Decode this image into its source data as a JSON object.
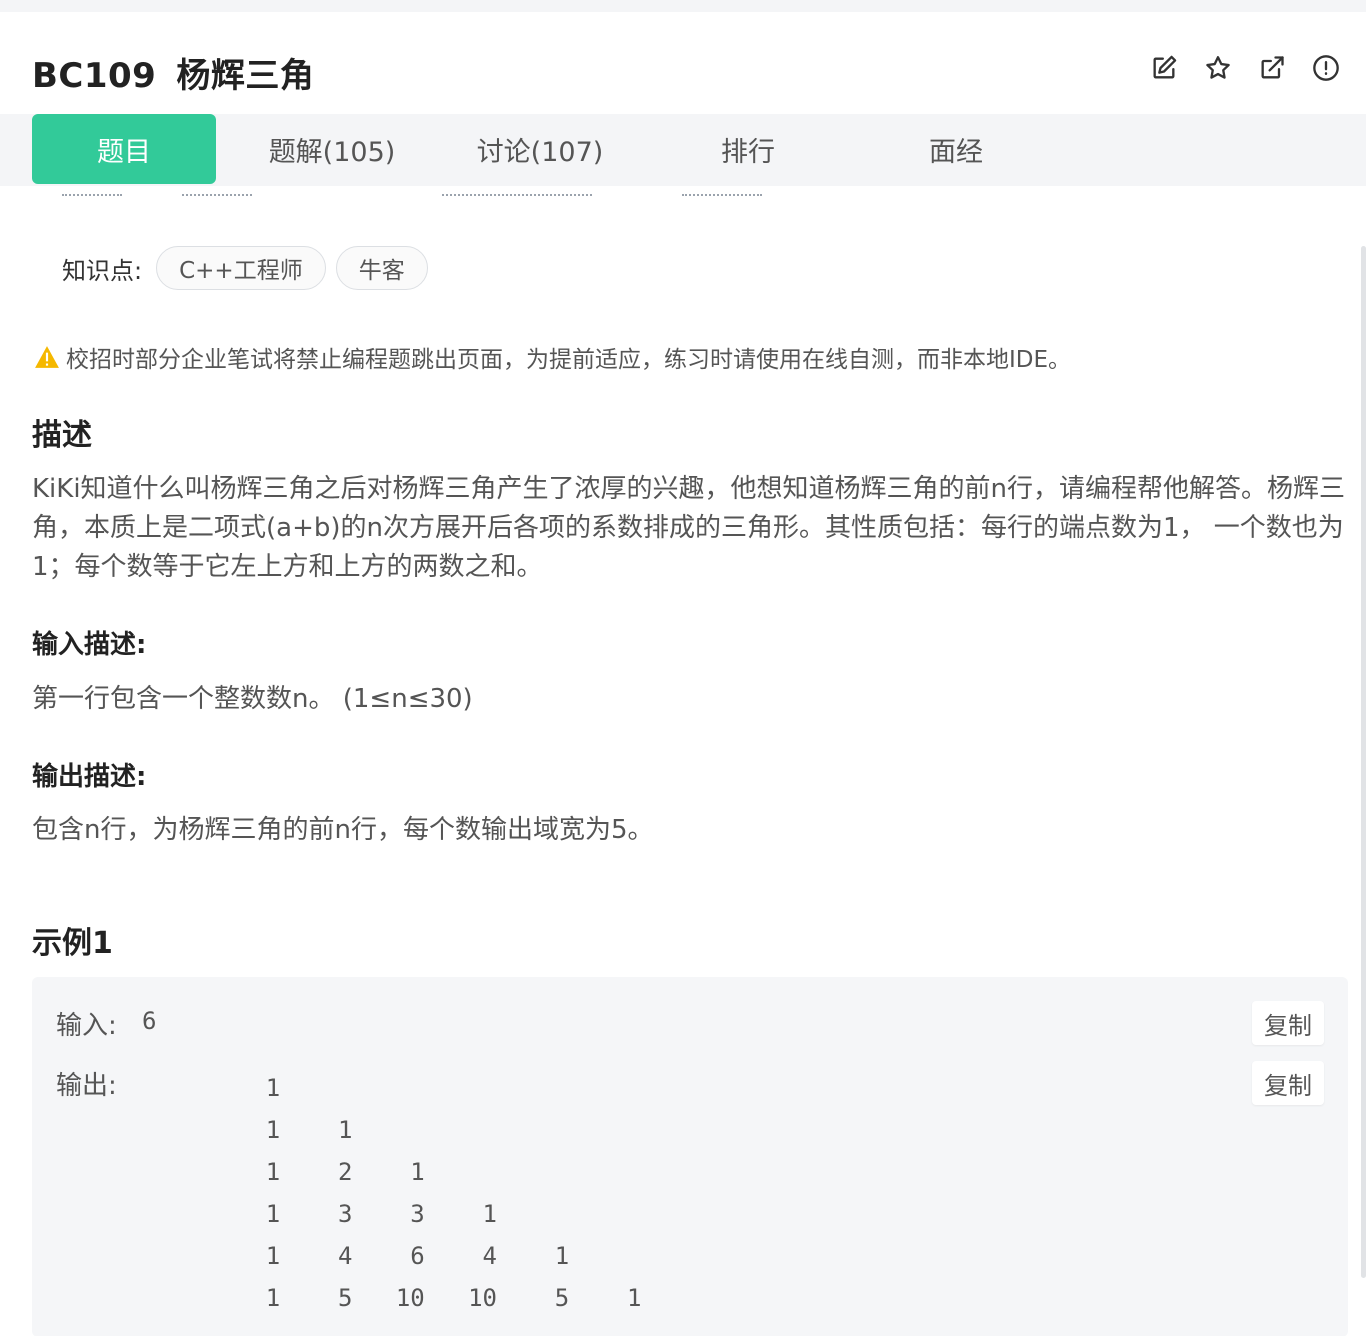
{
  "header": {
    "code": "BC109",
    "title": "杨辉三角",
    "icons": [
      "edit-icon",
      "star-icon",
      "share-icon",
      "report-icon"
    ]
  },
  "tabs": [
    {
      "label": "题目",
      "active": true
    },
    {
      "label": "题解(105)",
      "active": false
    },
    {
      "label": "讨论(107)",
      "active": false
    },
    {
      "label": "排行",
      "active": false
    },
    {
      "label": "面经",
      "active": false
    }
  ],
  "knowledge": {
    "label": "知识点:",
    "tags": [
      "C++工程师",
      "牛客"
    ]
  },
  "warning": {
    "icon": "warning-icon",
    "text": "校招时部分企业笔试将禁止编程题跳出页面，为提前适应，练习时请使用在线自测，而非本地IDE。"
  },
  "description": {
    "heading": "描述",
    "text": "KiKi知道什么叫杨辉三角之后对杨辉三角产生了浓厚的兴趣，他想知道杨辉三角的前n行，请编程帮他解答。杨辉三角，本质上是二项式(a+b)的n次方展开后各项的系数排成的三角形。其性质包括：每行的端点数为1， 一个数也为1；每个数等于它左上方和上方的两数之和。"
  },
  "input_desc": {
    "heading": "输入描述:",
    "text": "第一行包含一个整数数n。 (1≤n≤30)"
  },
  "output_desc": {
    "heading": "输出描述:",
    "text": "包含n行，为杨辉三角的前n行，每个数输出域宽为5。"
  },
  "example": {
    "heading": "示例1",
    "input_label": "输入:",
    "input_value": "6",
    "output_label": "输出:",
    "output_value": "    1\n    1    1\n    1    2    1\n    1    3    3    1\n    1    4    6    4    1\n    1    5   10   10    5    1",
    "copy_label": "复制"
  },
  "colors": {
    "accent": "#32ca99",
    "warning": "#f5b800",
    "tab_bar_bg": "#f4f5f7",
    "example_bg": "#f5f6f8"
  }
}
